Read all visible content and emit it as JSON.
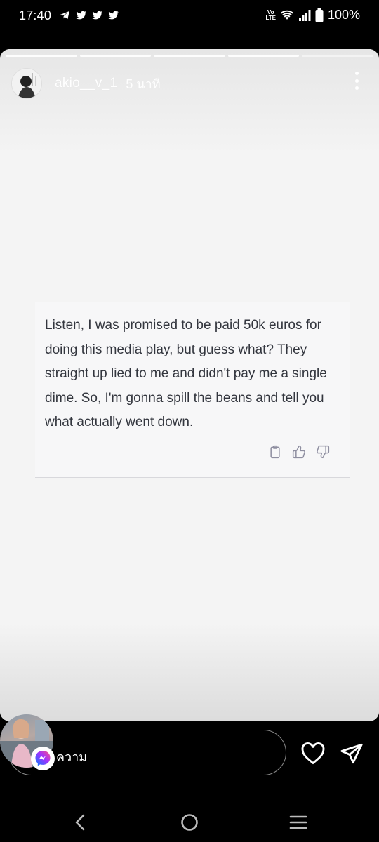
{
  "status_bar": {
    "time": "17:40",
    "notification_icons": [
      "telegram-icon",
      "twitter-icon",
      "twitter-icon",
      "twitter-icon"
    ],
    "volte_top": "Vo",
    "volte_bottom": "LTE",
    "battery": "100%"
  },
  "story": {
    "segments_total": 5,
    "username": "akio__v_1",
    "time_ago": "5 นาที",
    "message": "Listen, I was promised to be paid 50k euros for doing this media play, but guess what? They straight up lied to me and didn't pay me a single dime. So, I'm gonna spill the beans and tell you what actually went down.",
    "actions": [
      "clipboard-icon",
      "thumbs-up-icon",
      "thumbs-down-icon"
    ]
  },
  "reply": {
    "placeholder": "ความ"
  },
  "colors": {
    "story_bg": "#f4f4f4",
    "message_text": "#33363e",
    "action_icon": "#8e8ea0",
    "messenger_gradient": [
      "#0a7cff",
      "#a033ff",
      "#ff5280"
    ]
  }
}
